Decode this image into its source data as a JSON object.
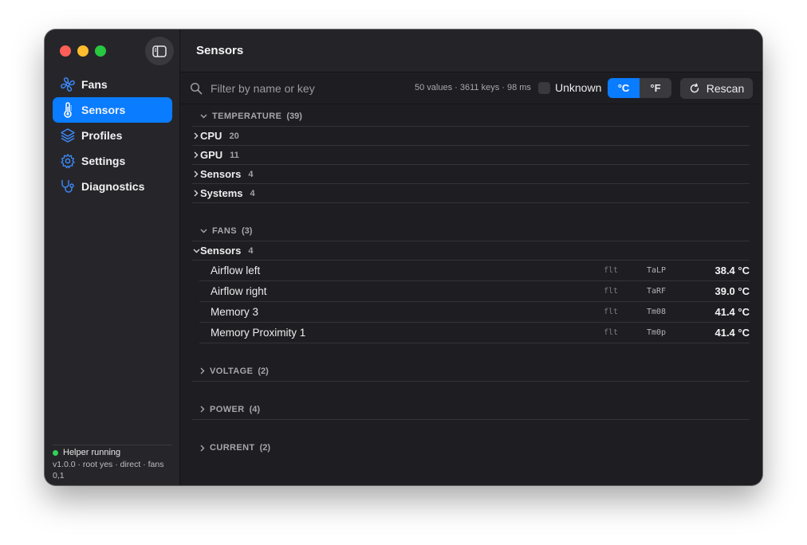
{
  "sidebar": {
    "items": [
      {
        "label": "Fans",
        "icon": "fan-icon"
      },
      {
        "label": "Sensors",
        "icon": "thermometer-icon",
        "active": true
      },
      {
        "label": "Profiles",
        "icon": "layers-icon"
      },
      {
        "label": "Settings",
        "icon": "gear-icon"
      },
      {
        "label": "Diagnostics",
        "icon": "stethoscope-icon"
      }
    ],
    "helper": {
      "status": "Helper running",
      "detail": "v1.0.0 · root yes · direct · fans 0,1"
    }
  },
  "header": {
    "title": "Sensors"
  },
  "toolbar": {
    "search_placeholder": "Filter by name or key",
    "stats": "50 values · 3611 keys · 98 ms",
    "unknown_label": "Unknown",
    "unit_c": "°C",
    "unit_f": "°F",
    "rescan_label": "Rescan"
  },
  "sections": {
    "temperature": {
      "label": "TEMPERATURE",
      "count": "(39)",
      "groups": [
        {
          "label": "CPU",
          "count": "20"
        },
        {
          "label": "GPU",
          "count": "11"
        },
        {
          "label": "Sensors",
          "count": "4"
        },
        {
          "label": "Systems",
          "count": "4"
        }
      ]
    },
    "fans": {
      "label": "FANS",
      "count": "(3)",
      "group": {
        "label": "Sensors",
        "count": "4"
      },
      "rows": [
        {
          "name": "Airflow left",
          "type": "flt",
          "key": "TaLP",
          "value": "38.4 °C"
        },
        {
          "name": "Airflow right",
          "type": "flt",
          "key": "TaRF",
          "value": "39.0 °C"
        },
        {
          "name": "Memory 3",
          "type": "flt",
          "key": "Tm08",
          "value": "41.4 °C"
        },
        {
          "name": "Memory Proximity 1",
          "type": "flt",
          "key": "Tm0p",
          "value": "41.4 °C"
        }
      ]
    },
    "voltage": {
      "label": "VOLTAGE",
      "count": "(2)"
    },
    "power": {
      "label": "POWER",
      "count": "(4)"
    },
    "current": {
      "label": "CURRENT",
      "count": "(2)"
    }
  },
  "colors": {
    "accent": "#0a7cff",
    "status_green": "#30d158"
  }
}
